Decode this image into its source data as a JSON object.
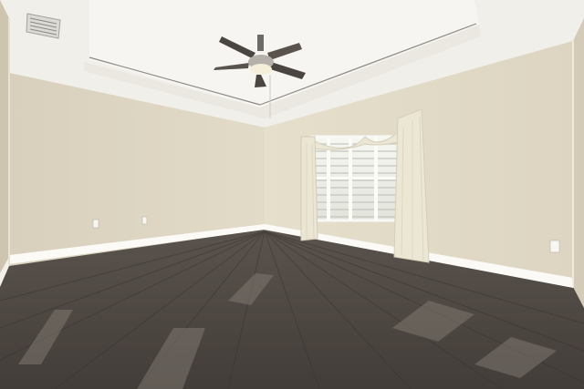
{
  "scene": {
    "description_visible_text": [],
    "elements": [
      "ceiling",
      "tray-ceiling",
      "ceiling-fan",
      "air-vent",
      "window",
      "curtain",
      "left-wall",
      "back-wall",
      "right-wall",
      "hardwood-floor",
      "baseboards",
      "electrical-outlets"
    ],
    "colors": {
      "wall": "#e3dcc9",
      "wall_shadow": "#d2cab6",
      "ceiling": "#f3f1ec",
      "floor_dark": "#4a4440",
      "floor_light": "#7a726b",
      "trim": "#fbfaf7",
      "curtain": "#ece7d5",
      "fan_blade": "#4b4541"
    }
  }
}
